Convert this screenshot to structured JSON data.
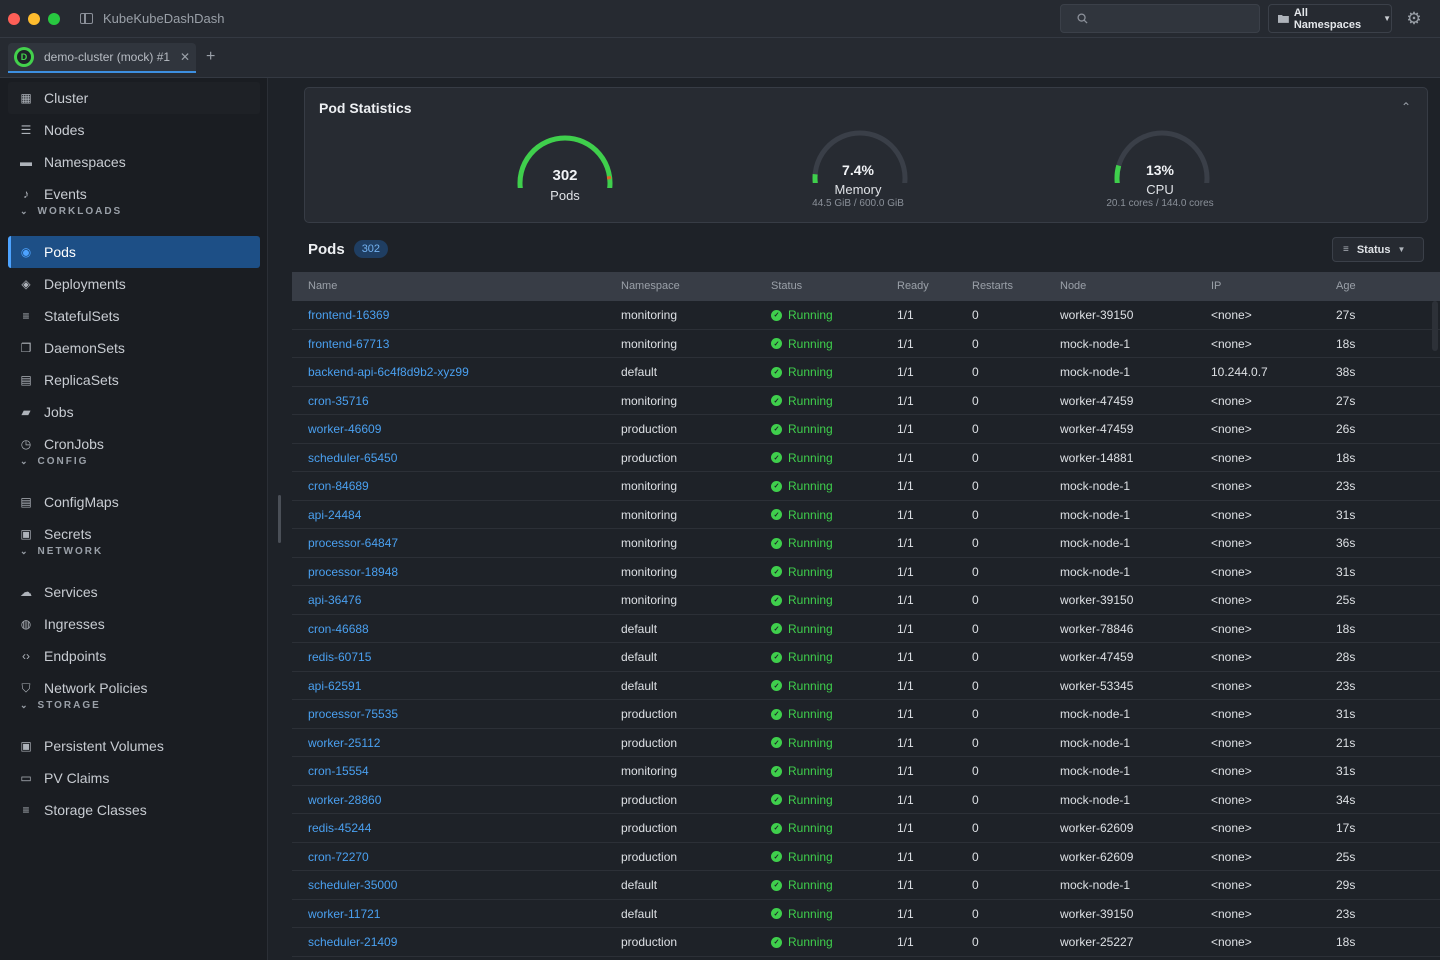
{
  "app": {
    "title": "KubeKubeDashDash"
  },
  "search": {
    "placeholder": "",
    "value": ""
  },
  "namespace_select": {
    "label": "All Namespaces"
  },
  "tabs": [
    {
      "badge": "D",
      "label": "demo-cluster (mock) #1"
    }
  ],
  "sidebar": {
    "items": [
      {
        "label": "Cluster",
        "icon": "grid-icon"
      },
      {
        "label": "Nodes",
        "icon": "server-icon"
      },
      {
        "label": "Namespaces",
        "icon": "folder-icon"
      },
      {
        "label": "Events",
        "icon": "bell-icon"
      },
      {
        "section": "WORKLOADS"
      },
      {
        "label": "Pods",
        "icon": "pod-icon",
        "active": true
      },
      {
        "label": "Deployments",
        "icon": "layers-icon"
      },
      {
        "label": "StatefulSets",
        "icon": "list-icon"
      },
      {
        "label": "DaemonSets",
        "icon": "copy-icon"
      },
      {
        "label": "ReplicaSets",
        "icon": "replica-icon"
      },
      {
        "label": "Jobs",
        "icon": "briefcase-icon"
      },
      {
        "label": "CronJobs",
        "icon": "clock-icon"
      },
      {
        "section": "CONFIG"
      },
      {
        "label": "ConfigMaps",
        "icon": "file-icon"
      },
      {
        "label": "Secrets",
        "icon": "lock-icon"
      },
      {
        "section": "NETWORK"
      },
      {
        "label": "Services",
        "icon": "cloud-icon"
      },
      {
        "label": "Ingresses",
        "icon": "globe-icon"
      },
      {
        "label": "Endpoints",
        "icon": "code-icon"
      },
      {
        "label": "Network Policies",
        "icon": "shield-icon"
      },
      {
        "section": "STORAGE"
      },
      {
        "label": "Persistent Volumes",
        "icon": "disk-icon"
      },
      {
        "label": "PV Claims",
        "icon": "folder-open-icon"
      },
      {
        "label": "Storage Classes",
        "icon": "lines-icon"
      }
    ]
  },
  "stats": {
    "title": "Pod Statistics",
    "pods": {
      "value": "302",
      "label": "Pods",
      "fraction": 1.0
    },
    "memory": {
      "value": "7.4%",
      "label": "Memory",
      "sub": "44.5 GiB / 600.0 GiB",
      "fraction": 0.074
    },
    "cpu": {
      "value": "13%",
      "label": "CPU",
      "sub": "20.1 cores / 144.0 cores",
      "fraction": 0.13
    },
    "colors": {
      "arc": "#3fcf4c",
      "track": "#3a3f48",
      "alert": "#e0632b"
    }
  },
  "pods": {
    "title": "Pods",
    "count": "302",
    "filter_label": "Status",
    "columns": [
      "Name",
      "Namespace",
      "Status",
      "Ready",
      "Restarts",
      "Node",
      "IP",
      "Age"
    ],
    "rows": [
      [
        "frontend-16369",
        "monitoring",
        "Running",
        "1/1",
        "0",
        "worker-39150",
        "<none>",
        "27s"
      ],
      [
        "frontend-67713",
        "monitoring",
        "Running",
        "1/1",
        "0",
        "mock-node-1",
        "<none>",
        "18s"
      ],
      [
        "backend-api-6c4f8d9b2-xyz99",
        "default",
        "Running",
        "1/1",
        "0",
        "mock-node-1",
        "10.244.0.7",
        "38s"
      ],
      [
        "cron-35716",
        "monitoring",
        "Running",
        "1/1",
        "0",
        "worker-47459",
        "<none>",
        "27s"
      ],
      [
        "worker-46609",
        "production",
        "Running",
        "1/1",
        "0",
        "worker-47459",
        "<none>",
        "26s"
      ],
      [
        "scheduler-65450",
        "production",
        "Running",
        "1/1",
        "0",
        "worker-14881",
        "<none>",
        "18s"
      ],
      [
        "cron-84689",
        "monitoring",
        "Running",
        "1/1",
        "0",
        "mock-node-1",
        "<none>",
        "23s"
      ],
      [
        "api-24484",
        "monitoring",
        "Running",
        "1/1",
        "0",
        "mock-node-1",
        "<none>",
        "31s"
      ],
      [
        "processor-64847",
        "monitoring",
        "Running",
        "1/1",
        "0",
        "mock-node-1",
        "<none>",
        "36s"
      ],
      [
        "processor-18948",
        "monitoring",
        "Running",
        "1/1",
        "0",
        "mock-node-1",
        "<none>",
        "31s"
      ],
      [
        "api-36476",
        "monitoring",
        "Running",
        "1/1",
        "0",
        "worker-39150",
        "<none>",
        "25s"
      ],
      [
        "cron-46688",
        "default",
        "Running",
        "1/1",
        "0",
        "worker-78846",
        "<none>",
        "18s"
      ],
      [
        "redis-60715",
        "default",
        "Running",
        "1/1",
        "0",
        "worker-47459",
        "<none>",
        "28s"
      ],
      [
        "api-62591",
        "default",
        "Running",
        "1/1",
        "0",
        "worker-53345",
        "<none>",
        "23s"
      ],
      [
        "processor-75535",
        "production",
        "Running",
        "1/1",
        "0",
        "mock-node-1",
        "<none>",
        "31s"
      ],
      [
        "worker-25112",
        "production",
        "Running",
        "1/1",
        "0",
        "mock-node-1",
        "<none>",
        "21s"
      ],
      [
        "cron-15554",
        "monitoring",
        "Running",
        "1/1",
        "0",
        "mock-node-1",
        "<none>",
        "31s"
      ],
      [
        "worker-28860",
        "production",
        "Running",
        "1/1",
        "0",
        "mock-node-1",
        "<none>",
        "34s"
      ],
      [
        "redis-45244",
        "production",
        "Running",
        "1/1",
        "0",
        "worker-62609",
        "<none>",
        "17s"
      ],
      [
        "cron-72270",
        "production",
        "Running",
        "1/1",
        "0",
        "worker-62609",
        "<none>",
        "25s"
      ],
      [
        "scheduler-35000",
        "default",
        "Running",
        "1/1",
        "0",
        "mock-node-1",
        "<none>",
        "29s"
      ],
      [
        "worker-11721",
        "default",
        "Running",
        "1/1",
        "0",
        "worker-39150",
        "<none>",
        "23s"
      ],
      [
        "scheduler-21409",
        "production",
        "Running",
        "1/1",
        "0",
        "worker-25227",
        "<none>",
        "18s"
      ]
    ]
  }
}
